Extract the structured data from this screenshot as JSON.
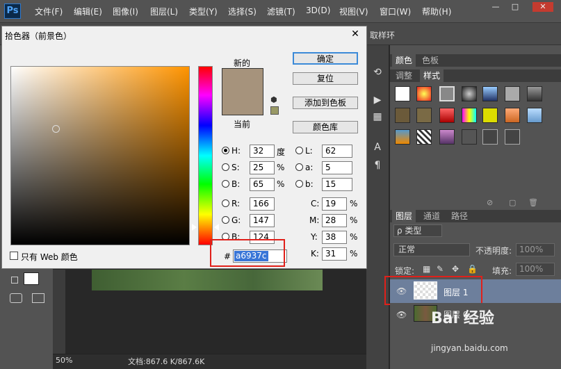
{
  "menubar": {
    "logo": "Ps",
    "items": [
      "文件(F)",
      "编辑(E)",
      "图像(I)",
      "图层(L)",
      "类型(Y)",
      "选择(S)",
      "滤镜(T)",
      "3D(D)",
      "视图(V)",
      "窗口(W)",
      "帮助(H)"
    ],
    "window_buttons": [
      "—",
      "□",
      "✕"
    ]
  },
  "options_bar": {
    "text": "取样环"
  },
  "dialog": {
    "title": "拾色器（前景色）",
    "close": "✕",
    "new_label": "新的",
    "current_label": "当前",
    "buttons": {
      "ok": "确定",
      "reset": "复位",
      "add_swatch": "添加到色板",
      "libraries": "颜色库"
    },
    "color_hex_value": "#a6937c",
    "hsb": [
      {
        "label": "H:",
        "value": "32",
        "unit": "度",
        "selected": true
      },
      {
        "label": "S:",
        "value": "25",
        "unit": "%",
        "selected": false
      },
      {
        "label": "B:",
        "value": "65",
        "unit": "%",
        "selected": false
      }
    ],
    "rgb": [
      {
        "label": "R:",
        "value": "166"
      },
      {
        "label": "G:",
        "value": "147"
      },
      {
        "label": "B:",
        "value": "124"
      }
    ],
    "lab": [
      {
        "label": "L:",
        "value": "62"
      },
      {
        "label": "a:",
        "value": "5"
      },
      {
        "label": "b:",
        "value": "15"
      }
    ],
    "cmyk": [
      {
        "label": "C:",
        "value": "19",
        "unit": "%"
      },
      {
        "label": "M:",
        "value": "28",
        "unit": "%"
      },
      {
        "label": "Y:",
        "value": "38",
        "unit": "%"
      },
      {
        "label": "K:",
        "value": "31",
        "unit": "%"
      }
    ],
    "hex_label": "#",
    "hex": "a6937c",
    "web_only": "只有 Web 颜色"
  },
  "panels": {
    "color_tabs": [
      "颜色",
      "色板"
    ],
    "style_tabs": [
      "调整",
      "样式"
    ],
    "layers_tabs": [
      "图层",
      "通道",
      "路径"
    ],
    "filter_kind": "ρ 类型",
    "blend_mode": "正常",
    "opacity_label": "不透明度:",
    "opacity_value": "100%",
    "lock_label": "锁定:",
    "fill_label": "填充:",
    "fill_value": "100%",
    "layers": [
      {
        "name": "图层 1",
        "selected": true
      },
      {
        "name": "图层 0",
        "selected": false
      }
    ]
  },
  "status": {
    "zoom": "50%",
    "doc": "文档:867.6 K/867.6K"
  },
  "watermark": {
    "main": "Bai  经验",
    "sub": "jingyan.baidu.com"
  },
  "colors": {
    "current_color": "#a6937c",
    "accent": "#e0201a",
    "selection": "#3875d7"
  }
}
